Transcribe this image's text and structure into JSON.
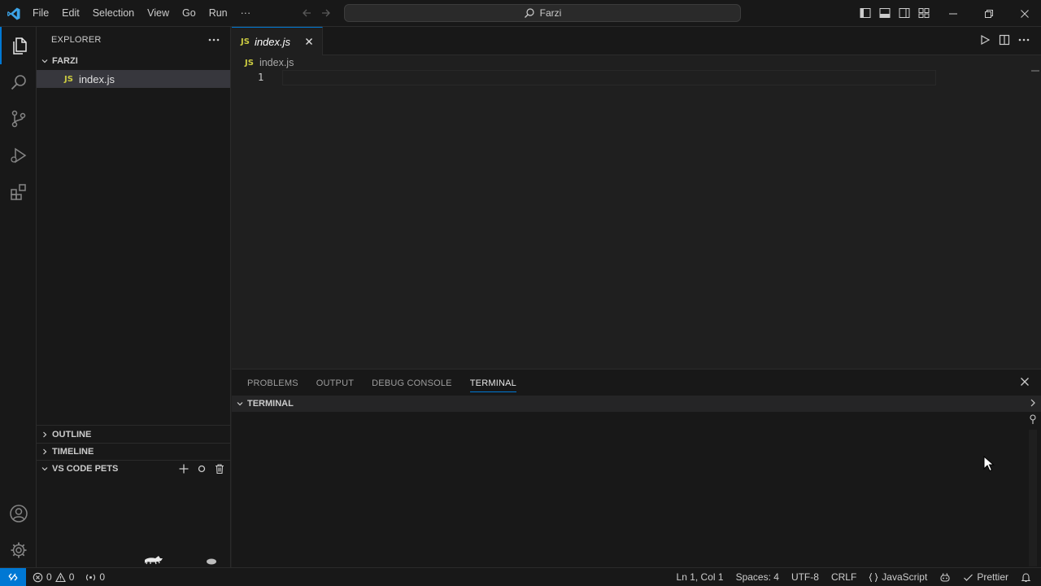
{
  "titlebar": {
    "menu": [
      "File",
      "Edit",
      "Selection",
      "View",
      "Go",
      "Run",
      "···"
    ],
    "search_text": "Farzi"
  },
  "sidebar": {
    "title": "EXPLORER",
    "folder": "FARZI",
    "file": {
      "badge": "JS",
      "name": "index.js"
    },
    "sections": {
      "outline": "OUTLINE",
      "timeline": "TIMELINE",
      "pets": "VS CODE PETS"
    }
  },
  "editor": {
    "tab": {
      "badge": "JS",
      "label": "index.js"
    },
    "breadcrumb": {
      "badge": "JS",
      "name": "index.js"
    },
    "line_number": "1"
  },
  "panel": {
    "tabs": [
      "PROBLEMS",
      "OUTPUT",
      "DEBUG CONSOLE",
      "TERMINAL"
    ],
    "active_tab": "TERMINAL",
    "section_title": "TERMINAL"
  },
  "statusbar": {
    "errors": "0",
    "warnings": "0",
    "ports": "0",
    "position": "Ln 1, Col 1",
    "spaces": "Spaces: 4",
    "encoding": "UTF-8",
    "eol": "CRLF",
    "language": "JavaScript",
    "formatter": "Prettier"
  },
  "colors": {
    "accent": "#0078d4",
    "js_badge": "#cbcb41",
    "background": "#1f1f1f",
    "chrome": "#181818"
  }
}
